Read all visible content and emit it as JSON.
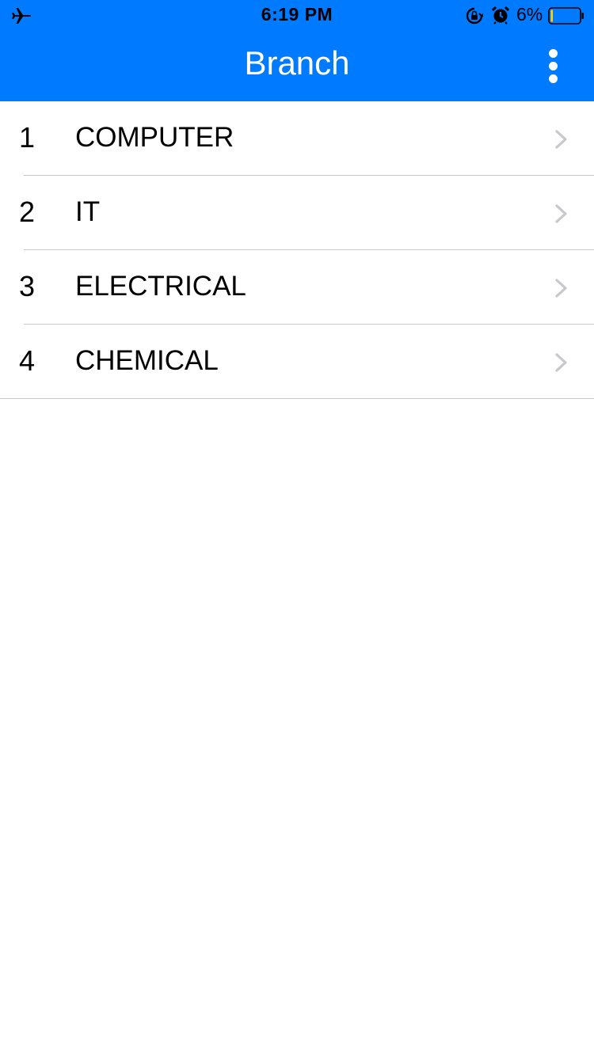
{
  "status_bar": {
    "time": "6:19 PM",
    "battery_percent": "6%",
    "icons": [
      "airplane-icon",
      "rotation-lock-icon",
      "alarm-icon",
      "battery-icon"
    ]
  },
  "nav": {
    "title": "Branch",
    "menu_icon": "more-vertical-icon"
  },
  "branches": [
    {
      "number": "1",
      "name": "COMPUTER"
    },
    {
      "number": "2",
      "name": "IT"
    },
    {
      "number": "3",
      "name": "ELECTRICAL"
    },
    {
      "number": "4",
      "name": "CHEMICAL"
    }
  ],
  "colors": {
    "accent": "#007aff",
    "separator": "#c8c7cc",
    "chevron": "#c7c7cc",
    "battery_level": "#ffd60a"
  }
}
